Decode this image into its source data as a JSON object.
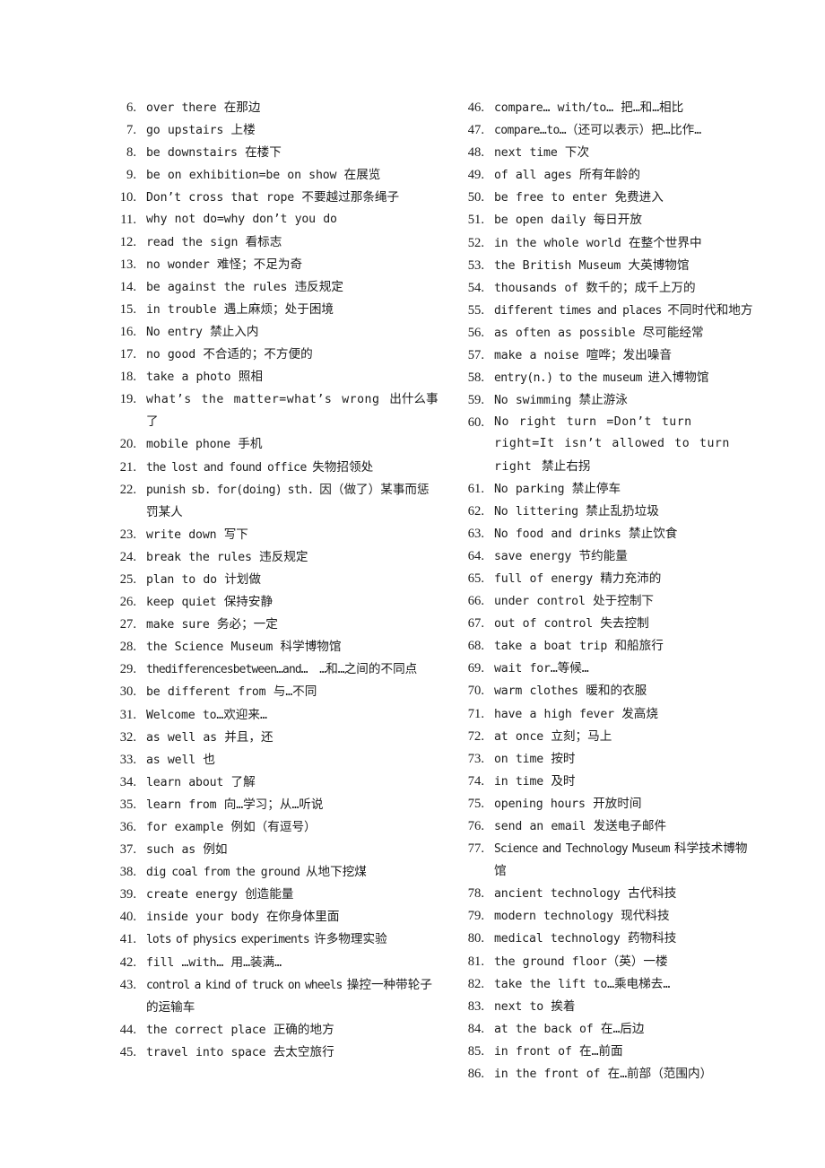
{
  "document": {
    "type": "phrase-list",
    "background_color": "#ffffff",
    "text_color": "#1c1c1c",
    "columns": 2,
    "numbering_style": "decimal-period",
    "first_item_number": 6,
    "last_item_number": 86
  },
  "left_column": {
    "items": [
      {
        "number": "6.",
        "text": "over there 在那边"
      },
      {
        "number": "7.",
        "text": "go upstairs 上楼"
      },
      {
        "number": "8.",
        "text": "be downstairs 在楼下"
      },
      {
        "number": "9.",
        "text": "be on exhibition=be on show 在展览"
      },
      {
        "number": "10.",
        "text": "Don’t cross that rope 不要越过那条绳子"
      },
      {
        "number": "11.",
        "text": "why not do=why don’t you do"
      },
      {
        "number": "12.",
        "text": "read the sign 看标志"
      },
      {
        "number": "13.",
        "text": "no wonder 难怪；不足为奇"
      },
      {
        "number": "14.",
        "text": "be against the rules 违反规定"
      },
      {
        "number": "15.",
        "text": "in trouble 遇上麻烦；处于困境"
      },
      {
        "number": "16.",
        "text": "No entry 禁止入内"
      },
      {
        "number": "17.",
        "text": "no good 不合适的；不方便的"
      },
      {
        "number": "18.",
        "text": "take a photo 照相"
      },
      {
        "number": "19.",
        "text": "what’s the matter=what’s wrong 出什么事了"
      },
      {
        "number": "20.",
        "text": "mobile phone 手机"
      },
      {
        "number": "21.",
        "text": "the lost and found office 失物招领处"
      },
      {
        "number": "22.",
        "text": "punish sb. for(doing) sth. 因（做了）某事而惩罚某人"
      },
      {
        "number": "23.",
        "text": "write down 写下"
      },
      {
        "number": "24.",
        "text": "break the rules 违反规定"
      },
      {
        "number": "25.",
        "text": "plan to do 计划做"
      },
      {
        "number": "26.",
        "text": "keep quiet 保持安静"
      },
      {
        "number": "27.",
        "text": "make sure 务必；一定"
      },
      {
        "number": "28.",
        "text": "the Science Museum 科学博物馆"
      },
      {
        "number": "29.",
        "text": "thedifferencesbetween…and…　…和…之间的不同点"
      },
      {
        "number": "30.",
        "text": "be different from 与…不同"
      },
      {
        "number": "31.",
        "text": "Welcome to…欢迎来…"
      },
      {
        "number": "32.",
        "text": "as well as 并且，还"
      },
      {
        "number": "33.",
        "text": "as well 也"
      },
      {
        "number": "34.",
        "text": "learn about 了解"
      },
      {
        "number": "35.",
        "text": "learn from 向…学习；从…听说"
      },
      {
        "number": "36.",
        "text": "for example 例如（有逗号）"
      },
      {
        "number": "37.",
        "text": "such as 例如"
      },
      {
        "number": "38.",
        "text": "dig coal from the ground 从地下挖煤"
      },
      {
        "number": "39.",
        "text": "create energy 创造能量"
      },
      {
        "number": "40.",
        "text": "inside your body 在你身体里面"
      },
      {
        "number": "41.",
        "text": "lots of physics experiments 许多物理实验"
      },
      {
        "number": "42.",
        "text": "fill …with… 用…装满…"
      },
      {
        "number": "43.",
        "text": "control a kind of truck on wheels 操控一种带轮子的运输车"
      },
      {
        "number": "44.",
        "text": "the correct place 正确的地方"
      },
      {
        "number": "45.",
        "text": "travel into space 去太空旅行"
      }
    ]
  },
  "right_column": {
    "items": [
      {
        "number": "46.",
        "text": "compare… with/to… 把…和…相比"
      },
      {
        "number": "47.",
        "text": "compare…to…（还可以表示）把…比作…"
      },
      {
        "number": "48.",
        "text": "next time 下次"
      },
      {
        "number": "49.",
        "text": "of all ages 所有年龄的"
      },
      {
        "number": "50.",
        "text": "be free to enter 免费进入"
      },
      {
        "number": "51.",
        "text": "be open daily 每日开放"
      },
      {
        "number": "52.",
        "text": "in the whole world 在整个世界中"
      },
      {
        "number": "53.",
        "text": "the British Museum 大英博物馆"
      },
      {
        "number": "54.",
        "text": "thousands of 数千的；成千上万的"
      },
      {
        "number": "55.",
        "text": "different times and places 不同时代和地方"
      },
      {
        "number": "56.",
        "text": "as often as possible 尽可能经常"
      },
      {
        "number": "57.",
        "text": "make a noise 喧哗；发出噪音"
      },
      {
        "number": "58.",
        "text": "entry(n.) to the museum 进入博物馆"
      },
      {
        "number": "59.",
        "text": "No swimming 禁止游泳"
      },
      {
        "number": "60.",
        "text": "No right turn =Don’t turn right=It isn’t allowed to turn right 禁止右拐"
      },
      {
        "number": "61.",
        "text": "No parking 禁止停车"
      },
      {
        "number": "62.",
        "text": "No littering 禁止乱扔垃圾"
      },
      {
        "number": "63.",
        "text": "No food and drinks 禁止饮食"
      },
      {
        "number": "64.",
        "text": "save energy 节约能量"
      },
      {
        "number": "65.",
        "text": "full of energy 精力充沛的"
      },
      {
        "number": "66.",
        "text": "under control 处于控制下"
      },
      {
        "number": "67.",
        "text": "out of control 失去控制"
      },
      {
        "number": "68.",
        "text": "take a boat trip 和船旅行"
      },
      {
        "number": "69.",
        "text": "wait for…等候…"
      },
      {
        "number": "70.",
        "text": "warm clothes 暖和的衣服"
      },
      {
        "number": "71.",
        "text": "have a high fever 发高烧"
      },
      {
        "number": "72.",
        "text": "at once 立刻；马上"
      },
      {
        "number": "73.",
        "text": "on time 按时"
      },
      {
        "number": "74.",
        "text": "in time 及时"
      },
      {
        "number": "75.",
        "text": "opening hours 开放时间"
      },
      {
        "number": "76.",
        "text": "send an email 发送电子邮件"
      },
      {
        "number": "77.",
        "text": "Science and Technology Museum 科学技术博物馆"
      },
      {
        "number": "78.",
        "text": "ancient technology 古代科技"
      },
      {
        "number": "79.",
        "text": "modern technology 现代科技"
      },
      {
        "number": "80.",
        "text": "medical technology 药物科技"
      },
      {
        "number": "81.",
        "text": "the ground floor（英）一楼"
      },
      {
        "number": "82.",
        "text": "take the lift to…乘电梯去…"
      },
      {
        "number": "83.",
        "text": "next to 挨着"
      },
      {
        "number": "84.",
        "text": "at the back of 在…后边"
      },
      {
        "number": "85.",
        "text": "in front of 在…前面"
      },
      {
        "number": "86.",
        "text": "in the front of 在…前部（范围内）"
      }
    ]
  }
}
